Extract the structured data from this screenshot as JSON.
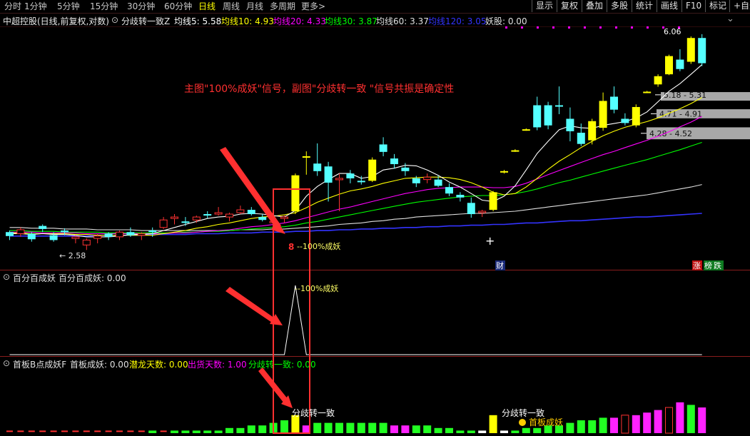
{
  "toolbar": {
    "periods": [
      "分时",
      "1分钟",
      "5分钟",
      "15分钟",
      "30分钟",
      "60分钟",
      "日线",
      "周线",
      "月线",
      "多周期",
      "更多"
    ],
    "active_period": "日线",
    "more_arrow": ">",
    "tools": [
      "显示",
      "复权",
      "叠加",
      "多股",
      "统计",
      "画线",
      "F10",
      "标记",
      "+自选"
    ]
  },
  "main_panel": {
    "stock_title": "中超控股(日线,前复权,对数)",
    "indicator_name": "分歧转一致Z",
    "ma_labels": [
      {
        "text": "均线5: 5.58",
        "color": "#ffffff"
      },
      {
        "text": "均线10: 4.93",
        "color": "#ffff00"
      },
      {
        "text": "均线20: 4.33",
        "color": "#ff00ff"
      },
      {
        "text": "均线30: 3.87",
        "color": "#00ff00"
      },
      {
        "text": "均线60: 3.37",
        "color": "#e0e0e0"
      },
      {
        "text": "均线120: 3.05",
        "color": "#3333ff"
      },
      {
        "text": "妖股: 0.00",
        "color": "#e0e0e0"
      }
    ],
    "annotation": "主图\"100%成妖\"信号，副图\"分歧转一致 \"信号共振是确定性",
    "low_label": "← 2.58",
    "high_label": "6.06",
    "signal_digit": "8",
    "signal_label": "100%成妖",
    "cai_label": "财",
    "zhang_label": "涨",
    "bang_label": "榜",
    "die_label": "跌",
    "price_zones": [
      {
        "label": "5.18 - 5.31",
        "y1": 5.18,
        "y2": 5.31
      },
      {
        "label": "4.71 - 4.91",
        "y1": 4.71,
        "y2": 4.91
      },
      {
        "label": "4.28 - 4.52",
        "y1": 4.28,
        "y2": 4.52
      }
    ]
  },
  "sub1": {
    "title": "百分百成妖",
    "value_label": "百分百成妖: 0.00",
    "peak_label": "100%成妖"
  },
  "sub2": {
    "title": "首板B点成妖F",
    "labels": [
      {
        "text": "首板成妖: 0.00",
        "color": "#e0e0e0"
      },
      {
        "text": "潜龙天数: 0.00",
        "color": "#ffff00"
      },
      {
        "text": "出货天数: 1.00",
        "color": "#ff00ff"
      },
      {
        "text": "分歧转一致: 0.00",
        "color": "#00ff00"
      }
    ],
    "signal1": "分歧转一致",
    "signal2": "分歧转一致",
    "signal3": "首板成妖"
  },
  "chart_data": {
    "type": "candlestick",
    "colors": {
      "up": "#ff3232",
      "down": "#54ffff",
      "zt": "#ffff00",
      "ma5": "#ffffff",
      "ma10": "#ffff00",
      "ma20": "#ff00ff",
      "ma30": "#00ff00",
      "ma60": "#e0e0e0",
      "ma120": "#3333ff"
    },
    "candles": [
      {
        "o": 2.8,
        "h": 2.82,
        "l": 2.7,
        "c": 2.75,
        "t": "d"
      },
      {
        "o": 2.78,
        "h": 2.86,
        "l": 2.74,
        "c": 2.83,
        "t": "u"
      },
      {
        "o": 2.78,
        "h": 2.8,
        "l": 2.68,
        "c": 2.71,
        "t": "d"
      },
      {
        "o": 2.84,
        "h": 2.9,
        "l": 2.8,
        "c": 2.88,
        "t": "d"
      },
      {
        "o": 2.76,
        "h": 2.8,
        "l": 2.68,
        "c": 2.7,
        "t": "d"
      },
      {
        "o": 2.82,
        "h": 2.85,
        "l": 2.76,
        "c": 2.8,
        "t": "d"
      },
      {
        "o": 2.72,
        "h": 2.76,
        "l": 2.66,
        "c": 2.74,
        "t": "u"
      },
      {
        "o": 2.64,
        "h": 2.72,
        "l": 2.58,
        "c": 2.7,
        "t": "u"
      },
      {
        "o": 2.72,
        "h": 2.78,
        "l": 2.66,
        "c": 2.75,
        "t": "u"
      },
      {
        "o": 2.78,
        "h": 2.8,
        "l": 2.7,
        "c": 2.74,
        "t": "d"
      },
      {
        "o": 2.74,
        "h": 2.82,
        "l": 2.7,
        "c": 2.8,
        "t": "u"
      },
      {
        "o": 2.8,
        "h": 2.86,
        "l": 2.74,
        "c": 2.76,
        "t": "d"
      },
      {
        "o": 2.76,
        "h": 2.8,
        "l": 2.7,
        "c": 2.78,
        "t": "u"
      },
      {
        "o": 2.8,
        "h": 2.86,
        "l": 2.74,
        "c": 2.82,
        "t": "d"
      },
      {
        "o": 2.86,
        "h": 3.0,
        "l": 2.84,
        "c": 2.96,
        "t": "u"
      },
      {
        "o": 2.98,
        "h": 3.04,
        "l": 2.9,
        "c": 3.0,
        "t": "u"
      },
      {
        "o": 2.94,
        "h": 3.0,
        "l": 2.88,
        "c": 2.92,
        "t": "d"
      },
      {
        "o": 2.96,
        "h": 3.02,
        "l": 2.92,
        "c": 3.0,
        "t": "u"
      },
      {
        "o": 3.02,
        "h": 3.08,
        "l": 2.98,
        "c": 3.04,
        "t": "d"
      },
      {
        "o": 3.06,
        "h": 3.14,
        "l": 3.02,
        "c": 3.04,
        "t": "u"
      },
      {
        "o": 3.0,
        "h": 3.06,
        "l": 2.94,
        "c": 3.04,
        "t": "u"
      },
      {
        "o": 3.06,
        "h": 3.16,
        "l": 3.04,
        "c": 3.1,
        "t": "u"
      },
      {
        "o": 3.1,
        "h": 3.14,
        "l": 3.02,
        "c": 3.04,
        "t": "d"
      },
      {
        "o": 3.0,
        "h": 3.04,
        "l": 2.94,
        "c": 2.96,
        "t": "d"
      },
      {
        "o": 2.93,
        "h": 2.96,
        "l": 2.88,
        "c": 2.94,
        "t": "u"
      },
      {
        "o": 2.98,
        "h": 3.02,
        "l": 2.92,
        "c": 3.0,
        "t": "u"
      },
      {
        "o": 3.08,
        "h": 3.66,
        "l": 3.04,
        "c": 3.63,
        "t": "z"
      },
      {
        "o": 3.94,
        "h": 4.05,
        "l": 3.64,
        "c": 3.96,
        "t": "z"
      },
      {
        "o": 3.83,
        "h": 4.2,
        "l": 3.62,
        "c": 3.7,
        "t": "d"
      },
      {
        "o": 3.78,
        "h": 3.86,
        "l": 3.22,
        "c": 3.51,
        "t": "d"
      },
      {
        "o": 3.58,
        "h": 3.66,
        "l": 3.08,
        "c": 3.56,
        "t": "u"
      },
      {
        "o": 3.66,
        "h": 3.72,
        "l": 3.5,
        "c": 3.58,
        "t": "d"
      },
      {
        "o": 3.54,
        "h": 3.62,
        "l": 3.48,
        "c": 3.52,
        "t": "d"
      },
      {
        "o": 3.54,
        "h": 3.94,
        "l": 3.52,
        "c": 3.9,
        "t": "z"
      },
      {
        "o": 4.18,
        "h": 4.32,
        "l": 3.96,
        "c": 4.04,
        "t": "d"
      },
      {
        "o": 3.92,
        "h": 4.0,
        "l": 3.74,
        "c": 3.82,
        "t": "d"
      },
      {
        "o": 3.76,
        "h": 3.84,
        "l": 3.62,
        "c": 3.7,
        "t": "d"
      },
      {
        "o": 3.5,
        "h": 3.62,
        "l": 3.44,
        "c": 3.58,
        "t": "d"
      },
      {
        "o": 3.6,
        "h": 3.66,
        "l": 3.5,
        "c": 3.56,
        "t": "u"
      },
      {
        "o": 3.56,
        "h": 3.62,
        "l": 3.44,
        "c": 3.46,
        "t": "d"
      },
      {
        "o": 3.44,
        "h": 3.5,
        "l": 3.3,
        "c": 3.34,
        "t": "d"
      },
      {
        "o": 3.32,
        "h": 3.36,
        "l": 3.22,
        "c": 3.28,
        "t": "d"
      },
      {
        "o": 3.2,
        "h": 3.28,
        "l": 2.99,
        "c": 3.04,
        "t": "d"
      },
      {
        "o": 3.06,
        "h": 3.1,
        "l": 3.0,
        "c": 3.08,
        "t": "u"
      },
      {
        "o": 3.1,
        "h": 3.38,
        "l": 3.08,
        "c": 3.36,
        "t": "z"
      },
      {
        "o": 3.7,
        "h": 3.72,
        "l": 3.66,
        "c": 3.7,
        "t": "z"
      },
      {
        "o": 4.07,
        "h": 4.09,
        "l": 4.04,
        "c": 4.07,
        "t": "z"
      },
      {
        "o": 4.48,
        "h": 4.5,
        "l": 4.45,
        "c": 4.48,
        "t": "z"
      },
      {
        "o": 5.0,
        "h": 5.2,
        "l": 4.46,
        "c": 4.52,
        "t": "d"
      },
      {
        "o": 5.0,
        "h": 5.08,
        "l": 4.48,
        "c": 4.56,
        "t": "d"
      },
      {
        "o": 5.0,
        "h": 5.45,
        "l": 4.8,
        "c": 5.0,
        "t": "d"
      },
      {
        "o": 4.7,
        "h": 4.95,
        "l": 4.24,
        "c": 4.44,
        "t": "d"
      },
      {
        "o": 4.41,
        "h": 4.6,
        "l": 4.15,
        "c": 4.19,
        "t": "d"
      },
      {
        "o": 4.26,
        "h": 4.7,
        "l": 4.18,
        "c": 4.65,
        "t": "z"
      },
      {
        "o": 4.51,
        "h": 5.3,
        "l": 4.45,
        "c": 5.1,
        "t": "z"
      },
      {
        "o": 5.2,
        "h": 5.45,
        "l": 4.82,
        "c": 4.9,
        "t": "d"
      },
      {
        "o": 4.7,
        "h": 4.82,
        "l": 4.56,
        "c": 4.61,
        "t": "d"
      },
      {
        "o": 4.56,
        "h": 5.02,
        "l": 4.52,
        "c": 4.96,
        "t": "z"
      },
      {
        "o": 5.32,
        "h": 5.34,
        "l": 5.3,
        "c": 5.32,
        "t": "z"
      },
      {
        "o": 5.5,
        "h": 5.76,
        "l": 5.44,
        "c": 5.71,
        "t": "z"
      },
      {
        "o": 5.76,
        "h": 6.3,
        "l": 5.74,
        "c": 6.26,
        "t": "z"
      },
      {
        "o": 6.16,
        "h": 6.46,
        "l": 5.84,
        "c": 5.9,
        "t": "d"
      },
      {
        "o": 6.1,
        "h": 6.85,
        "l": 6.04,
        "c": 6.8,
        "t": "z"
      },
      {
        "o": 6.8,
        "h": 6.92,
        "l": 5.98,
        "c": 6.06,
        "t": "d"
      }
    ],
    "ma5": [
      2.78,
      2.78,
      2.77,
      2.78,
      2.77,
      2.77,
      2.76,
      2.74,
      2.74,
      2.74,
      2.75,
      2.77,
      2.77,
      2.78,
      2.82,
      2.86,
      2.9,
      2.94,
      2.98,
      3.0,
      3.01,
      3.04,
      3.05,
      3.04,
      3.02,
      3.0,
      3.09,
      3.3,
      3.45,
      3.56,
      3.66,
      3.66,
      3.58,
      3.61,
      3.72,
      3.75,
      3.8,
      3.79,
      3.72,
      3.63,
      3.52,
      3.44,
      3.34,
      3.24,
      3.22,
      3.3,
      3.46,
      3.72,
      4.01,
      4.24,
      4.47,
      4.55,
      4.51,
      4.5,
      4.56,
      4.6,
      4.64,
      4.72,
      4.85,
      5.08,
      5.33,
      5.52,
      5.76,
      6.02
    ],
    "ma10": [
      2.79,
      2.79,
      2.78,
      2.78,
      2.78,
      2.78,
      2.77,
      2.77,
      2.76,
      2.76,
      2.76,
      2.76,
      2.76,
      2.76,
      2.78,
      2.8,
      2.82,
      2.85,
      2.87,
      2.9,
      2.92,
      2.95,
      2.98,
      3.0,
      3.01,
      3.03,
      3.06,
      3.13,
      3.21,
      3.27,
      3.33,
      3.38,
      3.41,
      3.45,
      3.5,
      3.54,
      3.58,
      3.59,
      3.6,
      3.6,
      3.59,
      3.56,
      3.51,
      3.44,
      3.36,
      3.32,
      3.34,
      3.44,
      3.58,
      3.73,
      3.87,
      3.99,
      4.12,
      4.24,
      4.35,
      4.44,
      4.52,
      4.58,
      4.64,
      4.72,
      4.82,
      4.92,
      5.04,
      5.18
    ],
    "ma20": [
      2.8,
      2.8,
      2.8,
      2.79,
      2.79,
      2.79,
      2.79,
      2.78,
      2.78,
      2.78,
      2.78,
      2.78,
      2.78,
      2.78,
      2.78,
      2.79,
      2.79,
      2.8,
      2.81,
      2.82,
      2.83,
      2.85,
      2.87,
      2.88,
      2.9,
      2.92,
      2.95,
      2.99,
      3.03,
      3.07,
      3.11,
      3.14,
      3.18,
      3.22,
      3.26,
      3.3,
      3.34,
      3.37,
      3.4,
      3.42,
      3.43,
      3.44,
      3.44,
      3.44,
      3.43,
      3.43,
      3.45,
      3.5,
      3.57,
      3.64,
      3.71,
      3.78,
      3.85,
      3.92,
      3.99,
      4.05,
      4.12,
      4.19,
      4.26,
      4.34,
      4.43,
      4.53,
      4.63,
      4.75
    ],
    "ma30": [
      2.82,
      2.82,
      2.81,
      2.81,
      2.81,
      2.8,
      2.8,
      2.8,
      2.8,
      2.79,
      2.79,
      2.79,
      2.79,
      2.79,
      2.79,
      2.79,
      2.8,
      2.8,
      2.81,
      2.81,
      2.82,
      2.83,
      2.84,
      2.85,
      2.86,
      2.87,
      2.89,
      2.92,
      2.94,
      2.97,
      3.0,
      3.03,
      3.06,
      3.09,
      3.12,
      3.15,
      3.18,
      3.21,
      3.23,
      3.25,
      3.27,
      3.29,
      3.3,
      3.31,
      3.31,
      3.32,
      3.34,
      3.37,
      3.41,
      3.46,
      3.51,
      3.55,
      3.6,
      3.65,
      3.7,
      3.75,
      3.8,
      3.85,
      3.9,
      3.96,
      4.02,
      4.08,
      4.15,
      4.22
    ],
    "ma60": [
      2.86,
      2.86,
      2.85,
      2.85,
      2.85,
      2.84,
      2.84,
      2.84,
      2.83,
      2.83,
      2.83,
      2.83,
      2.82,
      2.82,
      2.82,
      2.82,
      2.82,
      2.82,
      2.82,
      2.82,
      2.82,
      2.83,
      2.83,
      2.83,
      2.84,
      2.84,
      2.85,
      2.86,
      2.87,
      2.88,
      2.9,
      2.91,
      2.92,
      2.94,
      2.95,
      2.97,
      2.98,
      3.0,
      3.01,
      3.02,
      3.03,
      3.04,
      3.05,
      3.05,
      3.06,
      3.07,
      3.08,
      3.1,
      3.12,
      3.14,
      3.16,
      3.18,
      3.2,
      3.22,
      3.24,
      3.26,
      3.28,
      3.3,
      3.32,
      3.35,
      3.38,
      3.41,
      3.44,
      3.48
    ],
    "ma120": [
      2.75,
      2.75,
      2.75,
      2.75,
      2.75,
      2.75,
      2.75,
      2.75,
      2.76,
      2.76,
      2.76,
      2.76,
      2.76,
      2.77,
      2.77,
      2.77,
      2.77,
      2.78,
      2.78,
      2.78,
      2.79,
      2.79,
      2.79,
      2.8,
      2.8,
      2.8,
      2.81,
      2.81,
      2.82,
      2.82,
      2.83,
      2.83,
      2.84,
      2.84,
      2.85,
      2.85,
      2.86,
      2.86,
      2.87,
      2.87,
      2.88,
      2.88,
      2.89,
      2.89,
      2.9,
      2.9,
      2.91,
      2.92,
      2.92,
      2.93,
      2.94,
      2.95,
      2.95,
      2.96,
      2.97,
      2.98,
      2.99,
      3.0,
      3.0,
      3.01,
      3.02,
      3.03,
      3.04,
      3.05
    ],
    "sub1_values": [
      0,
      0,
      0,
      0,
      0,
      0,
      0,
      0,
      0,
      0,
      0,
      0,
      0,
      0,
      0,
      0,
      0,
      0,
      0,
      0,
      0,
      0,
      0,
      0,
      0,
      0,
      100,
      0,
      0,
      0,
      0,
      0,
      0,
      0,
      0,
      0,
      0,
      0,
      0,
      0,
      0,
      0,
      0,
      0,
      0,
      0,
      0,
      0,
      0,
      0,
      0,
      0,
      0,
      0,
      0,
      0,
      0,
      0,
      0,
      0,
      0,
      0,
      0,
      0
    ],
    "sub2_bars": [
      {
        "v": 1,
        "c": "r"
      },
      {
        "v": 1,
        "c": "r"
      },
      {
        "v": 1,
        "c": "r"
      },
      {
        "v": 1,
        "c": "r"
      },
      {
        "v": 1,
        "c": "r"
      },
      {
        "v": 1,
        "c": "r"
      },
      {
        "v": 1,
        "c": "r"
      },
      {
        "v": 1,
        "c": "r"
      },
      {
        "v": 1,
        "c": "r"
      },
      {
        "v": 1,
        "c": "r"
      },
      {
        "v": 1,
        "c": "r"
      },
      {
        "v": 1,
        "c": "r"
      },
      {
        "v": 1,
        "c": "r"
      },
      {
        "v": 1,
        "c": "g"
      },
      {
        "v": 1,
        "c": "r"
      },
      {
        "v": 1,
        "c": "g"
      },
      {
        "v": 1,
        "c": "g"
      },
      {
        "v": 1,
        "c": "g"
      },
      {
        "v": 1,
        "c": "g"
      },
      {
        "v": 1,
        "c": "g"
      },
      {
        "v": 2,
        "c": "g"
      },
      {
        "v": 2,
        "c": "g"
      },
      {
        "v": 3,
        "c": "g"
      },
      {
        "v": 3,
        "c": "g"
      },
      {
        "v": 4,
        "c": "g"
      },
      {
        "v": 5,
        "c": "g"
      },
      {
        "v": 7,
        "c": "y"
      },
      {
        "v": 3,
        "c": "m"
      },
      {
        "v": 4,
        "c": "g"
      },
      {
        "v": 4,
        "c": "g"
      },
      {
        "v": 4,
        "c": "g"
      },
      {
        "v": 4,
        "c": "g"
      },
      {
        "v": 4,
        "c": "g"
      },
      {
        "v": 4,
        "c": "g"
      },
      {
        "v": 4,
        "c": "g"
      },
      {
        "v": 3,
        "c": "m"
      },
      {
        "v": 3,
        "c": "m"
      },
      {
        "v": 3,
        "c": "g"
      },
      {
        "v": 3,
        "c": "g"
      },
      {
        "v": 2,
        "c": "g"
      },
      {
        "v": 2,
        "c": "g"
      },
      {
        "v": 1,
        "c": "g"
      },
      {
        "v": 1,
        "c": "g"
      },
      {
        "v": 1,
        "c": "w"
      },
      {
        "v": 7,
        "c": "y"
      },
      {
        "v": 1,
        "c": "w"
      },
      {
        "v": 1,
        "c": "g"
      },
      {
        "v": 2,
        "c": "g"
      },
      {
        "v": 2,
        "c": "g"
      },
      {
        "v": 3,
        "c": "g"
      },
      {
        "v": 3,
        "c": "g"
      },
      {
        "v": 4,
        "c": "g"
      },
      {
        "v": 5,
        "c": "g"
      },
      {
        "v": 5,
        "c": "g"
      },
      {
        "v": 6,
        "c": "g"
      },
      {
        "v": 6,
        "c": "m"
      },
      {
        "v": 7,
        "c": "r"
      },
      {
        "v": 7,
        "c": "m"
      },
      {
        "v": 8,
        "c": "m"
      },
      {
        "v": 9,
        "c": "m"
      },
      {
        "v": 10,
        "c": "r"
      },
      {
        "v": 12,
        "c": "m"
      },
      {
        "v": 11,
        "c": "g"
      },
      {
        "v": 10,
        "c": "m"
      }
    ],
    "y_range": [
      2.5,
      7.1
    ],
    "y_scale": "log"
  }
}
